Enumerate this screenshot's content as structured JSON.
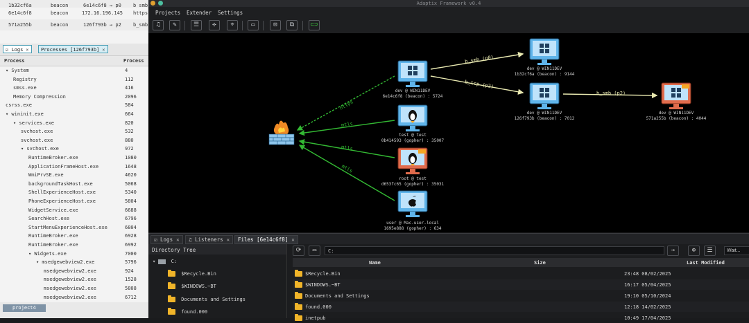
{
  "window": {
    "title": "Adaptix Framework v0.4"
  },
  "menu": [
    "Projects",
    "Extender",
    "Settings"
  ],
  "agents_table": [
    {
      "id": "1b32cf6a",
      "type": "beacon",
      "ext": "6e14c6f8 → p0",
      "extra": "b_smb"
    },
    {
      "id": "6e14c6f8",
      "type": "beacon",
      "ext": "172.16.196.145",
      "extra": "https"
    },
    {
      "id": "571a255b",
      "type": "beacon",
      "ext": "126f793b → p2",
      "extra": "b_smb"
    }
  ],
  "left_tabs": [
    {
      "label": "Logs"
    },
    {
      "label": "Processes [126f793b]"
    }
  ],
  "process_table": {
    "headers": [
      "Process",
      "Process"
    ],
    "rows": [
      {
        "name": "▾ System",
        "pid": "4",
        "indent": 0
      },
      {
        "name": "Registry",
        "pid": "112",
        "indent": 1
      },
      {
        "name": "smss.exe",
        "pid": "416",
        "indent": 1
      },
      {
        "name": "Memory Compression",
        "pid": "2096",
        "indent": 1
      },
      {
        "name": "csrss.exe",
        "pid": "584",
        "indent": 0
      },
      {
        "name": "▾ wininit.exe",
        "pid": "664",
        "indent": 0
      },
      {
        "name": "▾ services.exe",
        "pid": "820",
        "indent": 1
      },
      {
        "name": "svchost.exe",
        "pid": "532",
        "indent": 2
      },
      {
        "name": "svchost.exe",
        "pid": "880",
        "indent": 2
      },
      {
        "name": "▾ svchost.exe",
        "pid": "972",
        "indent": 2
      },
      {
        "name": "RuntimeBroker.exe",
        "pid": "1080",
        "indent": 3
      },
      {
        "name": "ApplicationFrameHost.exe",
        "pid": "1648",
        "indent": 3
      },
      {
        "name": "WmiPrvSE.exe",
        "pid": "4620",
        "indent": 3
      },
      {
        "name": "backgroundTaskHost.exe",
        "pid": "5068",
        "indent": 3
      },
      {
        "name": "ShellExperienceHost.exe",
        "pid": "5340",
        "indent": 3
      },
      {
        "name": "PhoneExperienceHost.exe",
        "pid": "5804",
        "indent": 3
      },
      {
        "name": "WidgetService.exe",
        "pid": "6688",
        "indent": 3
      },
      {
        "name": "SearchHost.exe",
        "pid": "6796",
        "indent": 3
      },
      {
        "name": "StartMenuExperienceHost.exe",
        "pid": "6804",
        "indent": 3
      },
      {
        "name": "RuntimeBroker.exe",
        "pid": "6928",
        "indent": 3
      },
      {
        "name": "RuntimeBroker.exe",
        "pid": "6992",
        "indent": 3
      },
      {
        "name": "▾ Widgets.exe",
        "pid": "7000",
        "indent": 3
      },
      {
        "name": "▾ msedgewebview2.exe",
        "pid": "5796",
        "indent": 4
      },
      {
        "name": "msedgewebview2.exe",
        "pid": "924",
        "indent": 5
      },
      {
        "name": "msedgewebview2.exe",
        "pid": "1528",
        "indent": 5
      },
      {
        "name": "msedgewebview2.exe",
        "pid": "5808",
        "indent": 5
      },
      {
        "name": "msedgewebview2.exe",
        "pid": "6712",
        "indent": 5
      }
    ]
  },
  "project_tab": "project4",
  "graph": {
    "nodes": {
      "n1": {
        "line1": "dev @ WIN11DEV",
        "line2": "1b32cf6a (beacon) : 9144"
      },
      "n2": {
        "line1": "dev @ WIN11DEV",
        "line2": "6e14c6f8 (beacon) : 5724"
      },
      "n3": {
        "line1": "dev @ WIN11DEV",
        "line2": "126f793b (beacon) : 7012"
      },
      "n4": {
        "line1": "dev @ WIN11DEV",
        "line2": "571a255b (beacon) : 4044"
      },
      "n5": {
        "line1": "test @ test",
        "line2": "0b414593 (gopher) : 35007"
      },
      "n6": {
        "line1": "root @ test",
        "line2": "d653fc65 (gopher) : 35031"
      },
      "n7": {
        "line1": "user @ Mac.user.local",
        "line2": "1695e888 (gopher) : 634"
      }
    },
    "edges": {
      "e1": "b_smb (p0)",
      "e2": "b_tcp (p2)",
      "e3": "b_smb (p2)",
      "e4": "https",
      "e5": "mtls",
      "e6": "mtls",
      "e7": "mtls"
    },
    "colors": {
      "pivot": "#e8e8b0",
      "c2": "#33b833",
      "monitor": "#5fb4ea",
      "monitor_alt": "#e06b4c"
    }
  },
  "bottom_tabs": [
    {
      "label": "Logs"
    },
    {
      "label": "Listeners"
    },
    {
      "label": "Files [6e14c6f8]"
    }
  ],
  "dir_tree": {
    "title": "Directory Tree",
    "root": "C:",
    "items": [
      "$Recycle.Bin",
      "$WINDOWS.~BT",
      "Documents and Settings",
      "found.000"
    ]
  },
  "files": {
    "path": "C:",
    "wait_label": "Wait...",
    "headers": [
      "Name",
      "Size",
      "Last Modified"
    ],
    "rows": [
      {
        "name": "$Recycle.Bin",
        "size": "",
        "modified": "23:48 08/02/2025"
      },
      {
        "name": "$WINDOWS.~BT",
        "size": "",
        "modified": "16:17 05/04/2025"
      },
      {
        "name": "Documents and Settings",
        "size": "",
        "modified": "19:10 05/10/2024"
      },
      {
        "name": "found.000",
        "size": "",
        "modified": "12:18 14/02/2025"
      },
      {
        "name": "inetpub",
        "size": "",
        "modified": "10:49 17/04/2025"
      }
    ]
  }
}
